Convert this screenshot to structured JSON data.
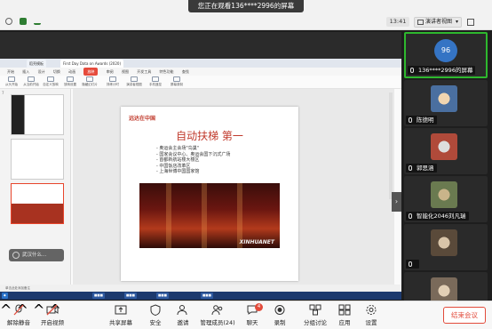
{
  "banner": "您正在观看136****2996的屏幕",
  "clock": "13:41",
  "view_button": "演讲者视图",
  "wps": {
    "tabs": [
      "稻壳模板",
      "First Day Data on Awards (2020)"
    ],
    "menu": [
      "开始",
      "插入",
      "设计",
      "切换",
      "动画",
      "放映",
      "审阅",
      "视图",
      "开发工具",
      "特色功能",
      "查找"
    ],
    "active_menu": "放映",
    "tools": [
      "从头开始",
      "从当前开始",
      "自定义放映",
      "放映设置",
      "隐藏幻灯片",
      "排练计时",
      "演讲者视图",
      "手机遥控",
      "屏幕录制"
    ]
  },
  "slide": {
    "subtitle": "远达在中国",
    "title": "自动扶梯 第一",
    "bullets": [
      "奥运会主会场\"鸟巢\"",
      "国家会议中心、奥运会国下沉式广场",
      "首都新航站楼大楼区",
      "中国饭店改革区",
      "上海世博中国国家馆"
    ],
    "watermark": "XINHUANET"
  },
  "popup": "武汉什么…",
  "notes": "单击此处添加备注",
  "participants": [
    {
      "name": "136****2996的屏幕",
      "avatar_text": "96",
      "type": "number",
      "active": true
    },
    {
      "name": "陈德明",
      "type": "photo",
      "color": "#4a6fa0"
    },
    {
      "name": "郭思涵",
      "type": "photo",
      "color": "#b04a3a"
    },
    {
      "name": "智能化2046刘凡瑞",
      "type": "photo",
      "color": "#6a7a50"
    },
    {
      "name": "",
      "type": "photo",
      "color": "#5a4a3a"
    },
    {
      "name": "",
      "type": "photo",
      "color": "#7a6a5a"
    }
  ],
  "toolbar": {
    "unmute": "解除静音",
    "start_video": "开启视频",
    "share_screen": "共享屏幕",
    "security": "安全",
    "invite": "邀请",
    "members": "管理成员(24)",
    "chat": "聊天",
    "chat_badge": "4",
    "record": "录制",
    "breakout": "分组讨论",
    "apps": "应用",
    "settings": "设置",
    "end": "结束会议"
  },
  "colors": {
    "accent": "#e24b3b",
    "active_tile": "#2eb82e"
  }
}
